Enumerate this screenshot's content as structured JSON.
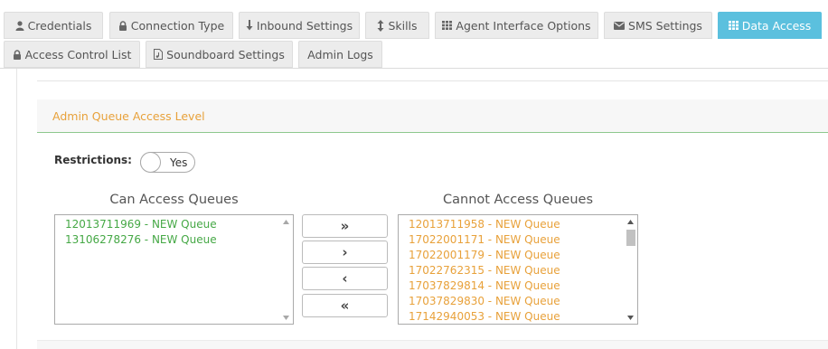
{
  "tabs": [
    {
      "label": "Credentials",
      "icon": "user-icon"
    },
    {
      "label": "Connection Type",
      "icon": "lock-icon"
    },
    {
      "label": "Inbound Settings",
      "icon": "arrow-down-icon"
    },
    {
      "label": "Skills",
      "icon": "arrows-vertical-icon"
    },
    {
      "label": "Agent Interface Options",
      "icon": "grid-icon"
    },
    {
      "label": "SMS Settings",
      "icon": "envelope-icon"
    },
    {
      "label": "Data Access",
      "icon": "grid-icon",
      "active": true
    },
    {
      "label": "Access Control List",
      "icon": "lock-icon"
    },
    {
      "label": "Soundboard Settings",
      "icon": "music-file-icon"
    },
    {
      "label": "Admin Logs",
      "icon": ""
    }
  ],
  "section": {
    "title": "Admin Queue Access Level"
  },
  "restrictions": {
    "label": "Restrictions:",
    "toggle_text": "Yes"
  },
  "can_access": {
    "title": "Can Access Queues",
    "items": [
      "12013711969 - NEW Queue",
      "13106278276 - NEW Queue"
    ]
  },
  "cannot_access": {
    "title": "Cannot Access Queues",
    "items": [
      "12013711958 - NEW Queue",
      "17022001171 - NEW Queue",
      "17022001179 - NEW Queue",
      "17022762315 - NEW Queue",
      "17037829814 - NEW Queue",
      "17037829830 - NEW Queue",
      "17142940053 - NEW Queue"
    ]
  },
  "move_buttons": {
    "move_all_right": "»",
    "move_right": "›",
    "move_left": "‹",
    "move_all_left": "«"
  },
  "colors": {
    "active_tab": "#5bc0de",
    "section_title": "#e8a13a",
    "can_access_text": "#45a845",
    "cannot_access_text": "#e8a13a",
    "section_underline": "#8dc88d"
  }
}
